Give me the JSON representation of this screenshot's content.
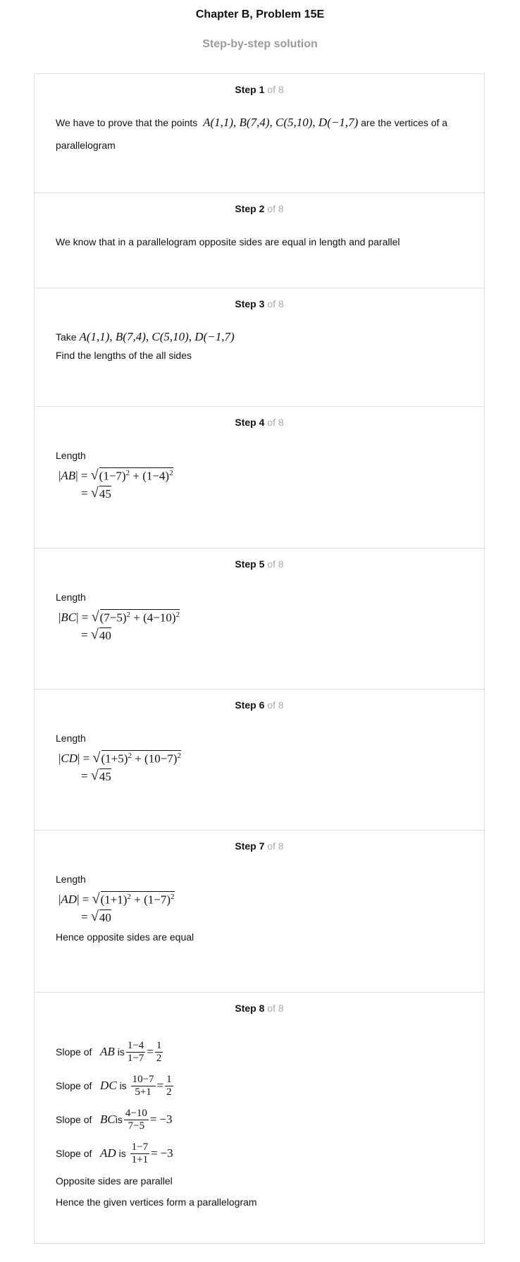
{
  "header": {
    "title": "Chapter B, Problem 15E",
    "subtitle": "Step-by-step solution"
  },
  "step_of_label": "of 8",
  "steps": [
    {
      "label": "Step 1",
      "intro": "We have to prove that the points",
      "points": "A(1,1), B(7,4), C(5,10), D(−1,7)",
      "after": "are the vertices of a",
      "after2": "parallelogram"
    },
    {
      "label": "Step 2",
      "text": "We know that in a parallelogram opposite sides are equal in length and parallel"
    },
    {
      "label": "Step 3",
      "take": "Take",
      "points": "A(1,1), B(7,4), C(5,10), D(−1,7)",
      "text": "Find the lengths of the all sides"
    },
    {
      "label": "Step 4",
      "length_label": "Length",
      "seg": "AB",
      "t1": "(1−7)",
      "t2": "(1−4)",
      "result": "45"
    },
    {
      "label": "Step 5",
      "length_label": "Length",
      "seg": "BC",
      "t1": "(7−5)",
      "t2": "(4−10)",
      "result": "40"
    },
    {
      "label": "Step 6",
      "length_label": "Length",
      "seg": "CD",
      "t1": "(1+5)",
      "t2": "(10−7)",
      "result": "45"
    },
    {
      "label": "Step 7",
      "length_label": "Length",
      "seg": "AD",
      "t1": "(1+1)",
      "t2": "(1−7)",
      "result": "40",
      "conclusion": "Hence opposite sides are equal"
    },
    {
      "label": "Step 8",
      "slope_prefix": "Slope of",
      "is_word": "is",
      "slopes": [
        {
          "seg": "AB",
          "num": "1−4",
          "den": "1−7",
          "eq": "=",
          "val_num": "1",
          "val_den": "2",
          "val": ""
        },
        {
          "seg": "DC",
          "num": "10−7",
          "den": "5+1",
          "eq": "=",
          "val_num": "1",
          "val_den": "2",
          "val": ""
        },
        {
          "seg": "BC",
          "num": "4−10",
          "den": "7−5",
          "eq": "=",
          "val_num": "",
          "val_den": "",
          "val": "−3"
        },
        {
          "seg": "AD",
          "num": "1−7",
          "den": "1+1",
          "eq": "=",
          "val_num": "",
          "val_den": "",
          "val": "−3"
        }
      ],
      "conclusion1": "Opposite sides are parallel",
      "conclusion2": "Hence the given vertices form a parallelogram"
    }
  ],
  "sym": {
    "eq": "=",
    "plus": "+",
    "sq": "2",
    "root": "√",
    "bar": "|"
  }
}
